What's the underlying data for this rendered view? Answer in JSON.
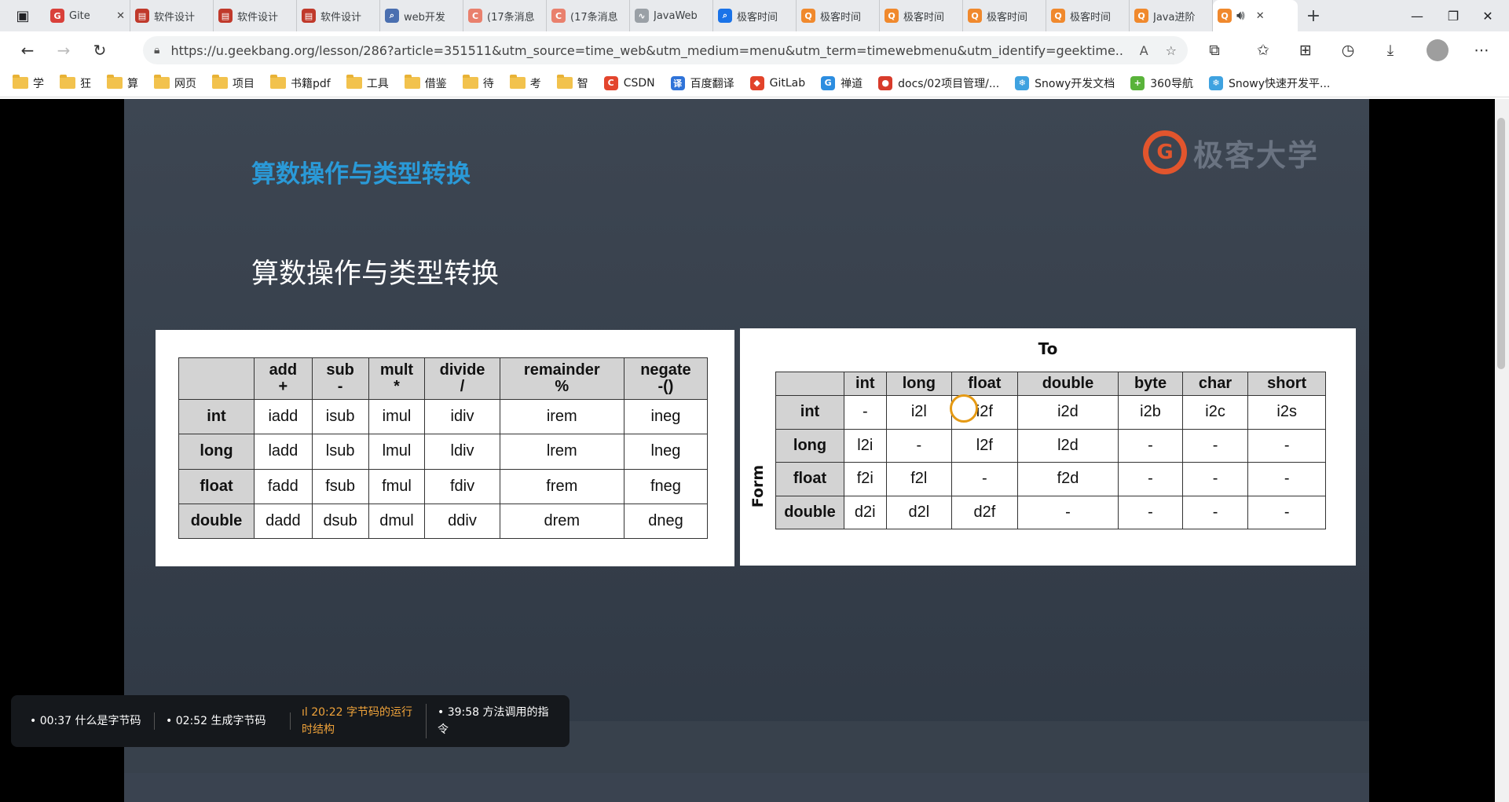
{
  "tabs": [
    {
      "label": "Gite",
      "fav": "gitee-icon",
      "color": "#d9403a",
      "w": 108
    },
    {
      "label": "软件设计",
      "fav": "pdf-icon",
      "color": "#c0392b",
      "w": 106
    },
    {
      "label": "软件设计",
      "fav": "pdf-icon",
      "color": "#c0392b",
      "w": 106
    },
    {
      "label": "软件设计",
      "fav": "pdf-icon",
      "color": "#c0392b",
      "w": 106
    },
    {
      "label": "web开发",
      "fav": "search-icon",
      "color": "#4a6fb0",
      "w": 106
    },
    {
      "label": "(17条消息",
      "fav": "csdn-icon",
      "color": "#e9806d",
      "w": 106
    },
    {
      "label": "(17条消息",
      "fav": "csdn-icon",
      "color": "#e9806d",
      "w": 106
    },
    {
      "label": "JavaWeb",
      "fav": "javaweb-icon",
      "color": "#9aa0a6",
      "w": 106
    },
    {
      "label": "极客时间",
      "fav": "search-icon",
      "color": "#1a73e8",
      "w": 106
    },
    {
      "label": "极客时间",
      "fav": "geek-icon",
      "color": "#f0892d",
      "w": 106
    },
    {
      "label": "极客时间",
      "fav": "geek-icon",
      "color": "#f0892d",
      "w": 106
    },
    {
      "label": "极客时间",
      "fav": "geek-icon",
      "color": "#f0892d",
      "w": 106
    },
    {
      "label": "极客时间",
      "fav": "geek-icon",
      "color": "#f0892d",
      "w": 106
    },
    {
      "label": "Java进阶",
      "fav": "geek-icon",
      "color": "#f0892d",
      "w": 106
    }
  ],
  "address": {
    "url": "https://u.geekbang.org/lesson/286?article=351511&utm_source=time_web&utm_medium=menu&utm_term=timewebmenu&utm_identify=geektime..."
  },
  "bookmarks": [
    {
      "label": "学",
      "type": "folder"
    },
    {
      "label": "狂",
      "type": "folder"
    },
    {
      "label": "算",
      "type": "folder"
    },
    {
      "label": "网页",
      "type": "folder"
    },
    {
      "label": "项目",
      "type": "folder"
    },
    {
      "label": "书籍pdf",
      "type": "folder"
    },
    {
      "label": "工具",
      "type": "folder"
    },
    {
      "label": "借鉴",
      "type": "folder"
    },
    {
      "label": "待",
      "type": "folder"
    },
    {
      "label": "考",
      "type": "folder"
    },
    {
      "label": "智",
      "type": "folder"
    },
    {
      "label": "CSDN",
      "type": "site",
      "icon": "csdn-icon",
      "color": "#e3452d"
    },
    {
      "label": "百度翻译",
      "type": "site",
      "icon": "translate-icon",
      "color": "#2f73d8"
    },
    {
      "label": "GitLab",
      "type": "site",
      "icon": "gitlab-icon",
      "color": "#e2432a"
    },
    {
      "label": "禅道",
      "type": "site",
      "icon": "zentao-icon",
      "color": "#2c8de0"
    },
    {
      "label": "docs/02项目管理/...",
      "type": "site",
      "icon": "chrome-icon",
      "color": "#d83b2b"
    },
    {
      "label": "Snowy开发文档",
      "type": "site",
      "icon": "snowy-icon",
      "color": "#3fa2e0"
    },
    {
      "label": "360导航",
      "type": "site",
      "icon": "nav360-icon",
      "color": "#59b33a"
    },
    {
      "label": "Snowy快速开发平...",
      "type": "site",
      "icon": "snowy-icon",
      "color": "#3fa2e0"
    }
  ],
  "slide": {
    "header": "算数操作与类型转换",
    "logo_text": "极客大学",
    "title": "算数操作与类型转换"
  },
  "table1": {
    "headers": [
      [
        "add",
        "+"
      ],
      [
        "sub",
        "-"
      ],
      [
        "mult",
        "*"
      ],
      [
        "divide",
        "/"
      ],
      [
        "remainder",
        "%"
      ],
      [
        "negate",
        "-()"
      ]
    ],
    "rows": [
      {
        "type": "int",
        "cells": [
          "iadd",
          "isub",
          "imul",
          "idiv",
          "irem",
          "ineg"
        ]
      },
      {
        "type": "long",
        "cells": [
          "ladd",
          "lsub",
          "lmul",
          "ldiv",
          "lrem",
          "lneg"
        ]
      },
      {
        "type": "float",
        "cells": [
          "fadd",
          "fsub",
          "fmul",
          "fdiv",
          "frem",
          "fneg"
        ]
      },
      {
        "type": "double",
        "cells": [
          "dadd",
          "dsub",
          "dmul",
          "ddiv",
          "drem",
          "dneg"
        ]
      }
    ]
  },
  "table2": {
    "to_label": "To",
    "from_label": "Form",
    "headers": [
      "int",
      "long",
      "float",
      "double",
      "byte",
      "char",
      "short"
    ],
    "rows": [
      {
        "type": "int",
        "cells": [
          "-",
          "i2l",
          "i2f",
          "i2d",
          "i2b",
          "i2c",
          "i2s"
        ]
      },
      {
        "type": "long",
        "cells": [
          "l2i",
          "-",
          "l2f",
          "l2d",
          "-",
          "-",
          "-"
        ]
      },
      {
        "type": "float",
        "cells": [
          "f2i",
          "f2l",
          "-",
          "f2d",
          "-",
          "-",
          "-"
        ]
      },
      {
        "type": "double",
        "cells": [
          "d2i",
          "d2l",
          "d2f",
          "-",
          "-",
          "-",
          "-"
        ]
      }
    ]
  },
  "chapters": [
    {
      "time": "00:37",
      "title": "什么是字节码",
      "current": false
    },
    {
      "time": "02:52",
      "title": "生成字节码",
      "current": false
    },
    {
      "time": "20:22",
      "title": "字节码的运行时结构",
      "current": true
    },
    {
      "time": "39:58",
      "title": "方法调用的指令",
      "current": false
    }
  ]
}
